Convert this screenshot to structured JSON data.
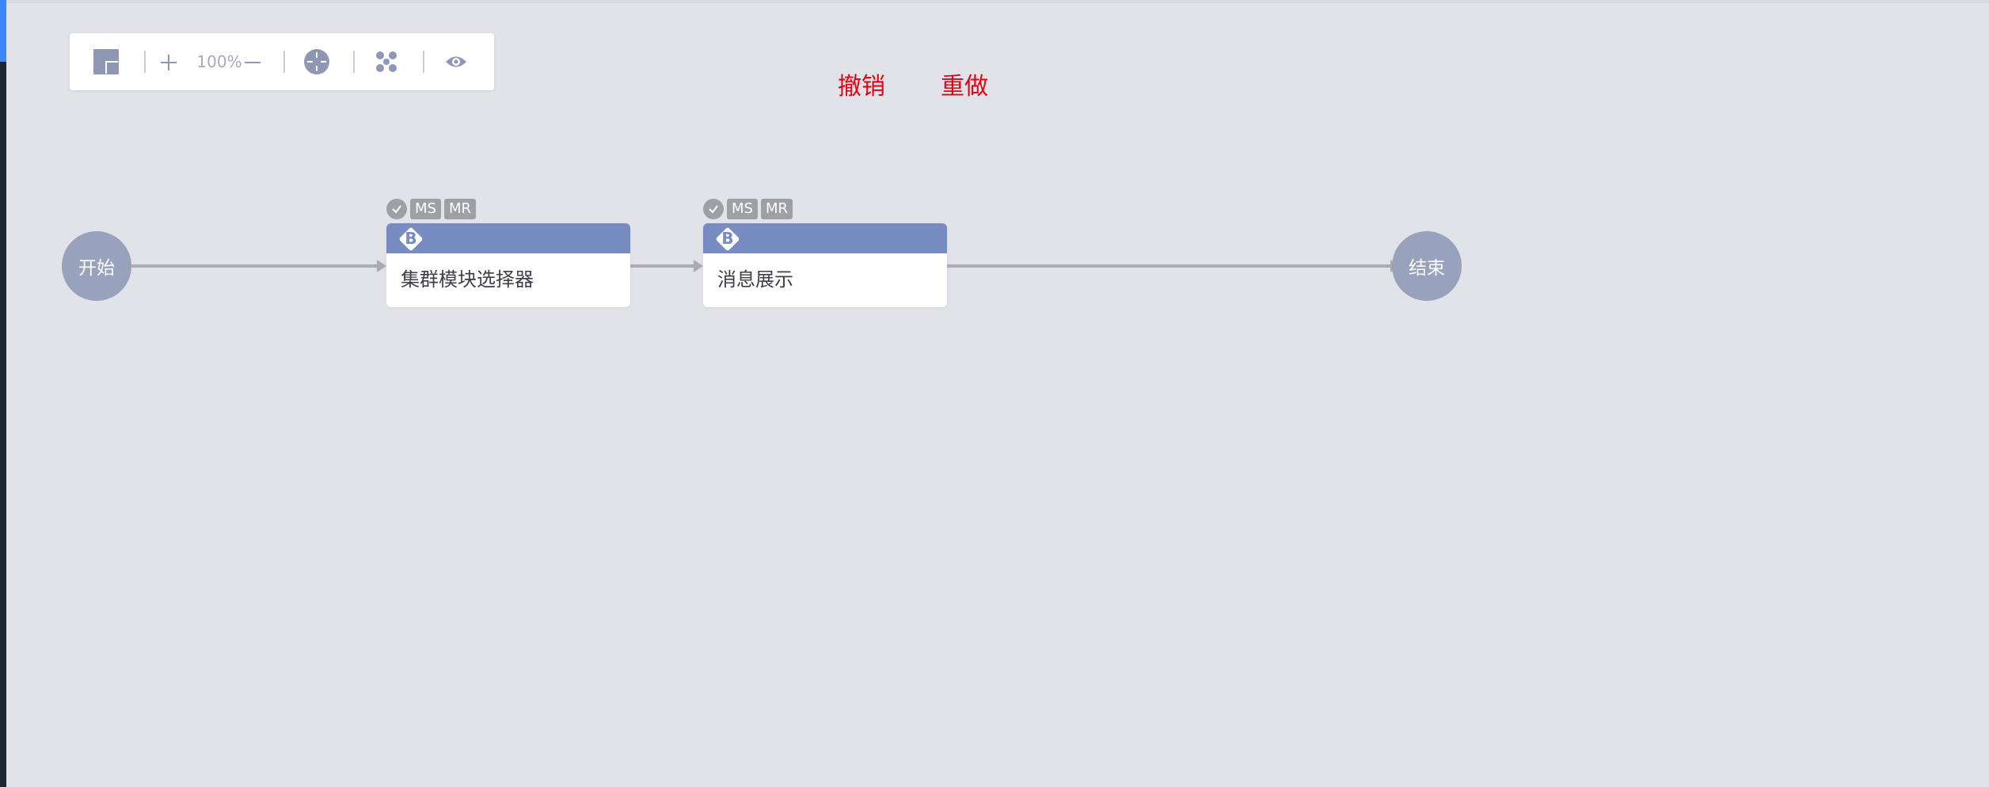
{
  "toolbar": {
    "zoom_level": "100%",
    "icons": [
      "minimap-icon",
      "zoom-in-icon",
      "zoom-out-icon",
      "locate-center-icon",
      "fit-view-icon",
      "preview-eye-icon"
    ]
  },
  "actions": {
    "undo_label": "撤销",
    "redo_label": "重做"
  },
  "flow": {
    "start_label": "开始",
    "end_label": "结束",
    "nodes": [
      {
        "badge": "B",
        "label": "集群模块选择器",
        "tags": [
          "MS",
          "MR"
        ]
      },
      {
        "badge": "B",
        "label": "消息展示",
        "tags": [
          "MS",
          "MR"
        ]
      }
    ]
  },
  "colors": {
    "canvas_bg": "#e1e3e8",
    "node_header": "#778cc1",
    "terminal_node": "#98a2bd",
    "edge": "#a7abb3",
    "action_text": "#e60012",
    "tag_bg": "#9ea0a6"
  }
}
